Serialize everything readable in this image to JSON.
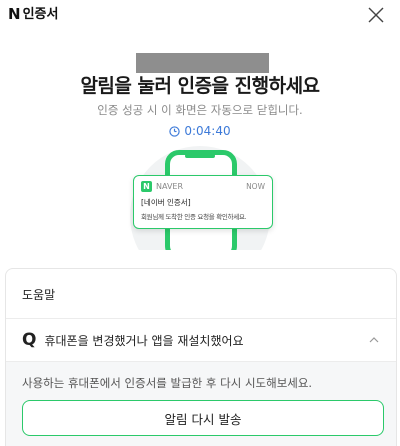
{
  "header": {
    "brand_mark": "N",
    "brand_label": "인증서"
  },
  "auth": {
    "title": "알림을 눌러 인증을 진행하세요",
    "subtitle": "인증 성공 시 이 화면은 자동으로 닫힙니다.",
    "timer": "0:04:40"
  },
  "notification": {
    "app_logo": "N",
    "app_name": "NAVER",
    "time": "NOW",
    "title": "[네이버 인증서]",
    "body": "회원님께 도착한 인증 요청을 확인하세요."
  },
  "help": {
    "heading": "도움말",
    "faq": {
      "q_mark": "Q",
      "question": "휴대폰을 변경했거나 앱을 재설치했어요",
      "answer": "사용하는 휴대폰에서 인증서를 발급한 후 다시 시도해보세요.",
      "button_label": "알림 다시 발송"
    }
  },
  "colors": {
    "accent_green": "#2bc96a",
    "timer_blue": "#3d7ad8"
  },
  "icons": [
    "close-icon",
    "clock-icon",
    "chevron-up-icon"
  ]
}
